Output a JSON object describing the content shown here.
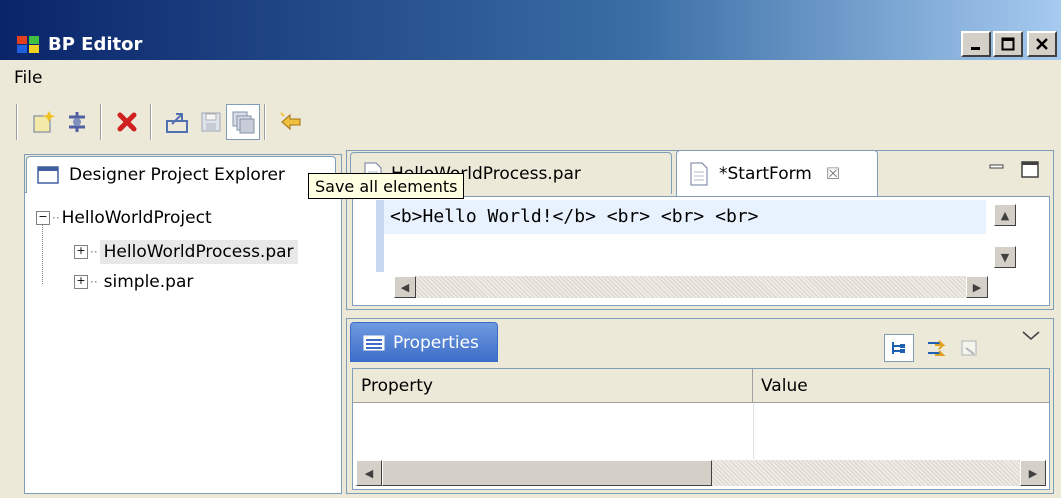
{
  "window": {
    "title": "BP Editor"
  },
  "menu": {
    "file_label": "File"
  },
  "toolbar": {
    "tooltip": "Save all elements"
  },
  "explorer": {
    "title": "Designer Project Explorer",
    "project": "HelloWorldProject",
    "items": [
      "HelloWorldProcess.par",
      "simple.par"
    ]
  },
  "editor": {
    "tabs": [
      {
        "label": "HelloWorldProcess.par"
      },
      {
        "label": "*StartForm"
      }
    ],
    "content": "<b>Hello World!</b> <br> <br> <br>"
  },
  "properties": {
    "title": "Properties",
    "columns": [
      "Property",
      "Value"
    ]
  },
  "colors": {
    "title_start": "#0a246a",
    "title_end": "#a6caf0",
    "selection": "#e8e8e8",
    "tooltip_bg": "#ffffe1"
  }
}
